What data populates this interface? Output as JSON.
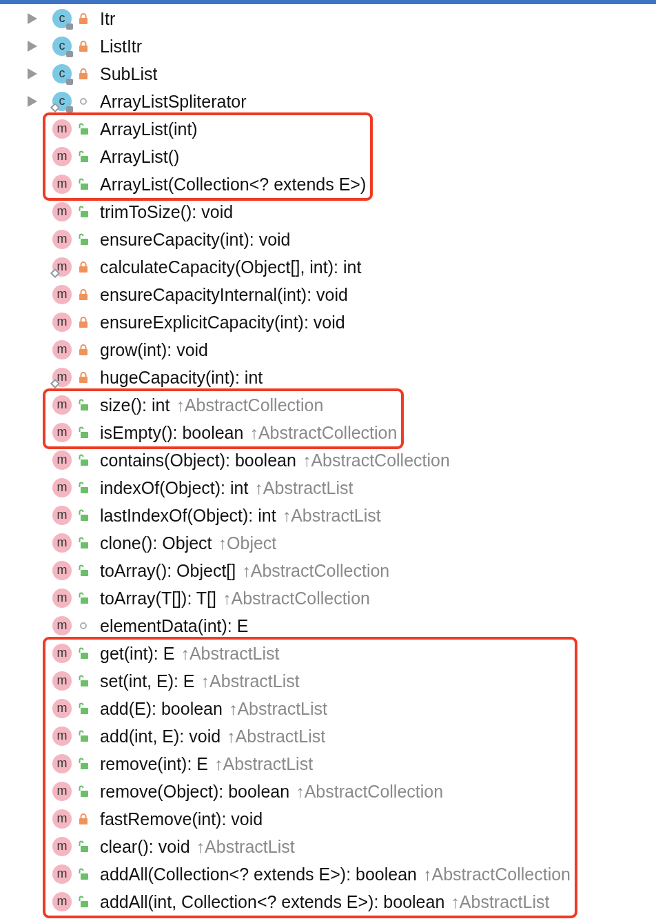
{
  "groups": [
    {
      "highlighted": false,
      "rows": [
        {
          "kind": "class",
          "icon": "c",
          "private": true,
          "public": false,
          "static": false,
          "expanded": false,
          "name": "Itr"
        },
        {
          "kind": "class",
          "icon": "c",
          "private": true,
          "public": false,
          "static": false,
          "expanded": false,
          "name": "ListItr"
        },
        {
          "kind": "class",
          "icon": "c",
          "private": true,
          "public": false,
          "static": false,
          "expanded": false,
          "name": "SubList"
        },
        {
          "kind": "class",
          "icon": "c",
          "private": false,
          "public": false,
          "static": true,
          "expanded": false,
          "name": "ArrayListSpliterator"
        }
      ]
    },
    {
      "highlighted": true,
      "rows": [
        {
          "kind": "method",
          "icon": "m",
          "private": false,
          "public": true,
          "static": false,
          "name": "ArrayList(int)"
        },
        {
          "kind": "method",
          "icon": "m",
          "private": false,
          "public": true,
          "static": false,
          "name": "ArrayList()"
        },
        {
          "kind": "method",
          "icon": "m",
          "private": false,
          "public": true,
          "static": false,
          "name": "ArrayList(Collection<? extends E>)"
        }
      ]
    },
    {
      "highlighted": false,
      "rows": [
        {
          "kind": "method",
          "icon": "m",
          "private": false,
          "public": true,
          "static": false,
          "name": "trimToSize(): void"
        },
        {
          "kind": "method",
          "icon": "m",
          "private": false,
          "public": true,
          "static": false,
          "name": "ensureCapacity(int): void"
        },
        {
          "kind": "method",
          "icon": "m",
          "private": true,
          "public": false,
          "static": true,
          "name": "calculateCapacity(Object[], int): int"
        },
        {
          "kind": "method",
          "icon": "m",
          "private": true,
          "public": false,
          "static": false,
          "name": "ensureCapacityInternal(int): void"
        },
        {
          "kind": "method",
          "icon": "m",
          "private": true,
          "public": false,
          "static": false,
          "name": "ensureExplicitCapacity(int): void"
        },
        {
          "kind": "method",
          "icon": "m",
          "private": true,
          "public": false,
          "static": false,
          "name": "grow(int): void"
        },
        {
          "kind": "method",
          "icon": "m",
          "private": true,
          "public": false,
          "static": true,
          "name": "hugeCapacity(int): int"
        }
      ]
    },
    {
      "highlighted": true,
      "rows": [
        {
          "kind": "method",
          "icon": "m",
          "private": false,
          "public": true,
          "static": false,
          "name": "size(): int",
          "inherited": "↑AbstractCollection"
        },
        {
          "kind": "method",
          "icon": "m",
          "private": false,
          "public": true,
          "static": false,
          "name": "isEmpty(): boolean",
          "inherited": "↑AbstractCollection"
        }
      ]
    },
    {
      "highlighted": false,
      "rows": [
        {
          "kind": "method",
          "icon": "m",
          "private": false,
          "public": true,
          "static": false,
          "name": "contains(Object): boolean",
          "inherited": "↑AbstractCollection"
        },
        {
          "kind": "method",
          "icon": "m",
          "private": false,
          "public": true,
          "static": false,
          "name": "indexOf(Object): int",
          "inherited": "↑AbstractList"
        },
        {
          "kind": "method",
          "icon": "m",
          "private": false,
          "public": true,
          "static": false,
          "name": "lastIndexOf(Object): int",
          "inherited": "↑AbstractList"
        },
        {
          "kind": "method",
          "icon": "m",
          "private": false,
          "public": true,
          "static": false,
          "name": "clone(): Object",
          "inherited": "↑Object"
        },
        {
          "kind": "method",
          "icon": "m",
          "private": false,
          "public": true,
          "static": false,
          "name": "toArray(): Object[]",
          "inherited": "↑AbstractCollection"
        },
        {
          "kind": "method",
          "icon": "m",
          "private": false,
          "public": true,
          "static": false,
          "name": "toArray(T[]): T[]",
          "inherited": "↑AbstractCollection"
        },
        {
          "kind": "method",
          "icon": "m",
          "private": false,
          "public": false,
          "static": false,
          "name": "elementData(int): E"
        }
      ]
    },
    {
      "highlighted": true,
      "rows": [
        {
          "kind": "method",
          "icon": "m",
          "private": false,
          "public": true,
          "static": false,
          "name": "get(int): E",
          "inherited": "↑AbstractList"
        },
        {
          "kind": "method",
          "icon": "m",
          "private": false,
          "public": true,
          "static": false,
          "name": "set(int, E): E",
          "inherited": "↑AbstractList"
        },
        {
          "kind": "method",
          "icon": "m",
          "private": false,
          "public": true,
          "static": false,
          "name": "add(E): boolean",
          "inherited": "↑AbstractList"
        },
        {
          "kind": "method",
          "icon": "m",
          "private": false,
          "public": true,
          "static": false,
          "name": "add(int, E): void",
          "inherited": "↑AbstractList"
        },
        {
          "kind": "method",
          "icon": "m",
          "private": false,
          "public": true,
          "static": false,
          "name": "remove(int): E",
          "inherited": "↑AbstractList"
        },
        {
          "kind": "method",
          "icon": "m",
          "private": false,
          "public": true,
          "static": false,
          "name": "remove(Object): boolean",
          "inherited": "↑AbstractCollection"
        },
        {
          "kind": "method",
          "icon": "m",
          "private": true,
          "public": false,
          "static": false,
          "name": "fastRemove(int): void"
        },
        {
          "kind": "method",
          "icon": "m",
          "private": false,
          "public": true,
          "static": false,
          "name": "clear(): void",
          "inherited": "↑AbstractList"
        },
        {
          "kind": "method",
          "icon": "m",
          "private": false,
          "public": true,
          "static": false,
          "name": "addAll(Collection<? extends E>): boolean",
          "inherited": "↑AbstractCollection"
        },
        {
          "kind": "method",
          "icon": "m",
          "private": false,
          "public": true,
          "static": false,
          "name": "addAll(int, Collection<? extends E>): boolean",
          "inherited": "↑AbstractList"
        }
      ]
    }
  ]
}
